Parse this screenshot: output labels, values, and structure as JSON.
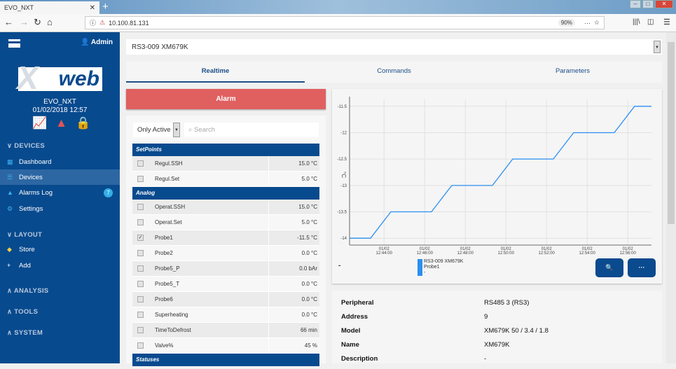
{
  "browser": {
    "tab_title": "EVO_NXT",
    "url": "10.100.81.131",
    "zoom": "90%"
  },
  "sidebar": {
    "user": "Admin",
    "logo": "Xweb",
    "system_name": "EVO_NXT",
    "datetime": "01/02/2018 12:57",
    "sections": [
      {
        "title": "DEVICES",
        "items": [
          {
            "label": "Dashboard",
            "icon": "dashboard-icon"
          },
          {
            "label": "Devices",
            "icon": "devices-icon",
            "active": true
          },
          {
            "label": "Alarms Log",
            "icon": "alarm-icon",
            "badge": "7"
          },
          {
            "label": "Settings",
            "icon": "gear-icon"
          }
        ]
      },
      {
        "title": "LAYOUT",
        "items": [
          {
            "label": "Store",
            "icon": "store-icon"
          },
          {
            "label": "Add",
            "icon": "plus-icon"
          }
        ]
      },
      {
        "title": "ANALYSIS"
      },
      {
        "title": "TOOLS"
      },
      {
        "title": "SYSTEM"
      }
    ]
  },
  "device_select": "RS3-009 XM679K",
  "tabs": [
    "Realtime",
    "Commands",
    "Parameters"
  ],
  "alarm_label": "Alarm",
  "filter": {
    "selected": "Only Active",
    "search_placeholder": "Search"
  },
  "groups": [
    {
      "name": "SetPoints",
      "rows": [
        {
          "name": "Regul.SSH",
          "value": "15.0 °C"
        },
        {
          "name": "Regul.Set",
          "value": "5.0 °C"
        }
      ]
    },
    {
      "name": "Analog",
      "rows": [
        {
          "name": "Operat.SSH",
          "value": "15.0 °C"
        },
        {
          "name": "Operat.Set",
          "value": "5.0 °C"
        },
        {
          "name": "Probe1",
          "value": "-11.5 °C",
          "checked": true
        },
        {
          "name": "Probe2",
          "value": "0.0 °C"
        },
        {
          "name": "Probe5_P",
          "value": "0.0 bAr"
        },
        {
          "name": "Probe5_T",
          "value": "0.0 °C"
        },
        {
          "name": "Probe6",
          "value": "0.0 °C"
        },
        {
          "name": "Superheating",
          "value": "0.0 °C"
        },
        {
          "name": "TimeToDefrost",
          "value": "66 min"
        },
        {
          "name": "Valve%",
          "value": "45 %"
        }
      ]
    },
    {
      "name": "Statuses",
      "rows": []
    }
  ],
  "chart_data": {
    "type": "line",
    "ylabel": "°C",
    "ylim": [
      -14.13,
      -11.37
    ],
    "y_ticks": [
      "-11.5",
      "-12",
      "-12.5",
      "-13",
      "-13.5",
      "-14"
    ],
    "x_ticks": [
      {
        "date": "01/02",
        "time": "12:44:00"
      },
      {
        "date": "01/02",
        "time": "12:46:00"
      },
      {
        "date": "01/02",
        "time": "12:48:00"
      },
      {
        "date": "01/02",
        "time": "12:50:00"
      },
      {
        "date": "01/02",
        "time": "12:52:00"
      },
      {
        "date": "01/02",
        "time": "12:54:00"
      },
      {
        "date": "01/02",
        "time": "12:56:00"
      }
    ],
    "xlim": [
      "12:42:18",
      "12:57:10"
    ],
    "series": [
      {
        "name": "RS3-009 XM679K Probe1",
        "color": "#2b8ff0",
        "points": [
          [
            "12:42:18",
            -14
          ],
          [
            "12:43:20",
            -14
          ],
          [
            "12:44:20",
            -13.5
          ],
          [
            "12:46:20",
            -13.5
          ],
          [
            "12:47:20",
            -13
          ],
          [
            "12:49:20",
            -13
          ],
          [
            "12:50:20",
            -12.5
          ],
          [
            "12:52:20",
            -12.5
          ],
          [
            "12:53:20",
            -12
          ],
          [
            "12:55:20",
            -12
          ],
          [
            "12:56:20",
            -11.5
          ],
          [
            "12:57:10",
            -11.5
          ]
        ]
      }
    ],
    "legend": {
      "line1": "RS3-009 XM679K",
      "line2": "Probe1",
      "line3": "-"
    },
    "legend_left": "-"
  },
  "info": [
    {
      "k": "Peripheral",
      "v": "RS485 3 (RS3)"
    },
    {
      "k": "Address",
      "v": "9"
    },
    {
      "k": "Model",
      "v": "XM679K 50 / 3.4 / 1.8"
    },
    {
      "k": "Name",
      "v": "XM679K"
    },
    {
      "k": "Description",
      "v": "-"
    }
  ]
}
